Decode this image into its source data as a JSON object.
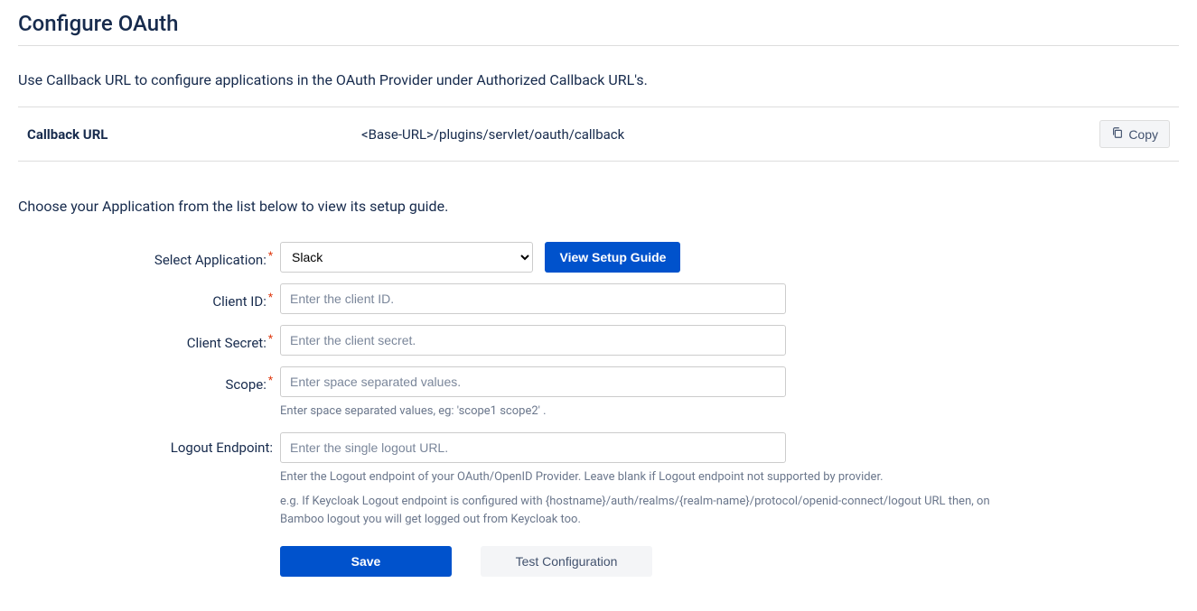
{
  "title": "Configure OAuth",
  "intro": "Use Callback URL to configure applications in the OAuth Provider under Authorized Callback URL's.",
  "callback": {
    "label": "Callback URL",
    "value": "<Base-URL>/plugins/servlet/oauth/callback",
    "copy": "Copy"
  },
  "choose_text": "Choose your Application from the list below to view its setup guide.",
  "form": {
    "select_app": {
      "label": "Select Application:",
      "value": "Slack",
      "button": "View Setup Guide"
    },
    "client_id": {
      "label": "Client ID:",
      "placeholder": "Enter the client ID."
    },
    "client_secret": {
      "label": "Client Secret:",
      "placeholder": "Enter the client secret."
    },
    "scope": {
      "label": "Scope:",
      "placeholder": "Enter space separated values.",
      "help": "Enter space separated values, eg: 'scope1 scope2' ."
    },
    "logout": {
      "label": "Logout Endpoint:",
      "placeholder": "Enter the single logout URL.",
      "help1": "Enter the Logout endpoint of your OAuth/OpenID Provider. Leave blank if Logout endpoint not supported by provider.",
      "help2": "e.g. If Keycloak Logout endpoint is configured with {hostname}/auth/realms/{realm-name}/protocol/openid-connect/logout URL then, on Bamboo logout you will get logged out from Keycloak too."
    },
    "save": "Save",
    "test": "Test Configuration"
  }
}
